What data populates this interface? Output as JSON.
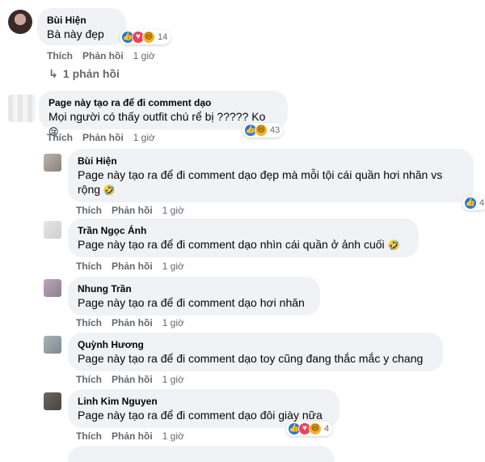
{
  "comments": [
    {
      "name": "Bùi Hiện",
      "text": "Bà này đẹp",
      "reactions": {
        "count": "14"
      },
      "actions": {
        "like": "Thích",
        "reply": "Phản hồi",
        "time": "1 giờ"
      }
    },
    {
      "replies_link": "1 phản hồi"
    },
    {
      "name": "Page này tạo ra để đi comment dạo",
      "text": "Mọi người có thấy outfit chú rể bị ????? Ko",
      "reactions": {
        "count": "43"
      },
      "actions": {
        "like": "Thích",
        "reply": "Phản hồi",
        "time": "1 giờ"
      }
    }
  ],
  "replies": [
    {
      "name": "Bùi Hiện",
      "text_line1": "Page này tạo ra để đi comment dạo đẹp mà mỗi tội cái quần hơi nhăn vs",
      "text_line2": "rộng",
      "reactions": {
        "count": "4"
      },
      "actions": {
        "like": "Thích",
        "reply": "Phản hồi",
        "time": "1 giờ"
      }
    },
    {
      "name": "Trần Ngọc Ánh",
      "text": "Page này tạo ra để đi comment dạo nhìn cái quần ở ảnh cuối",
      "actions": {
        "like": "Thích",
        "reply": "Phản hồi",
        "time": "1 giờ"
      }
    },
    {
      "name": "Nhung Trần",
      "text": "Page này tạo ra để đi comment dạo hơi nhăn",
      "actions": {
        "like": "Thích",
        "reply": "Phản hồi",
        "time": "1 giờ"
      }
    },
    {
      "name": "Quỳnh Hương",
      "text": "Page này tạo ra để đi comment dạo toy cũng đang thắc mắc y chang",
      "actions": {
        "like": "Thích",
        "reply": "Phản hồi",
        "time": "1 giờ"
      }
    },
    {
      "name": "Linh Kim Nguyen",
      "text": "Page này tạo ra để đi comment dạo đôi giày nữa",
      "reactions": {
        "count": "4"
      },
      "actions": {
        "like": "Thích",
        "reply": "Phản hồi",
        "time": "1 giờ"
      }
    }
  ],
  "colors": {
    "bubble": "#f0f2f5",
    "meta": "#65676b",
    "like": "#1877f2",
    "love": "#f33e58",
    "haha": "#f7b125"
  },
  "icons": {
    "reply_arrow": "reply-arrow-icon",
    "like": "like-icon",
    "love": "love-icon",
    "haha": "haha-icon"
  }
}
